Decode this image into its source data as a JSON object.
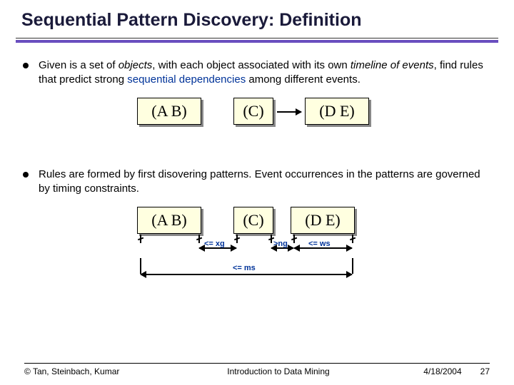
{
  "title": "Sequential Pattern Discovery: Definition",
  "bullets": {
    "b1_part1": "Given is a set of ",
    "b1_em1": "objects",
    "b1_part2": ", with each object associated with its own ",
    "b1_em2": "timeline of events",
    "b1_part3": ", find rules that predict strong ",
    "b1_em3": "sequential dependencies",
    "b1_part4": " among different events.",
    "b2": "Rules are formed by first disovering patterns. Event occurrences in the patterns are governed by timing constraints."
  },
  "boxes": {
    "ab": "(A   B)",
    "c": "(C)",
    "de": "(D   E)"
  },
  "labels": {
    "xg": "<= xg",
    "ng": ">ng",
    "ws": "<= ws",
    "ms": "<= ms"
  },
  "footer": {
    "copyright": "© Tan, Steinbach, Kumar",
    "center": "Introduction to Data Mining",
    "date": "4/18/2004",
    "page": "27"
  }
}
